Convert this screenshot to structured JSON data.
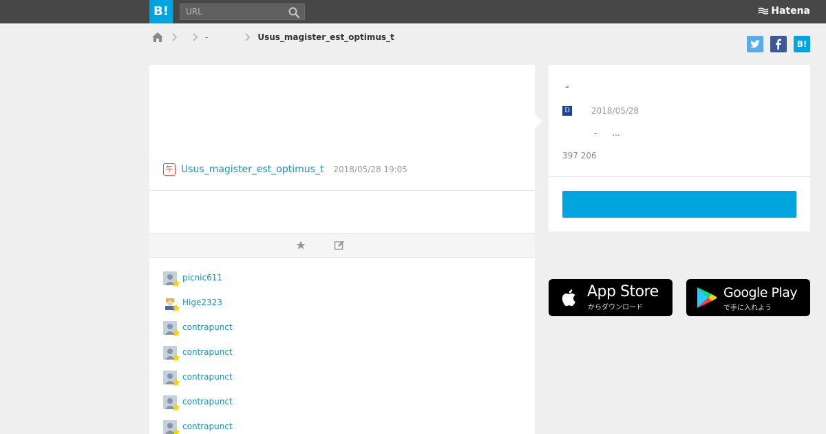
{
  "header": {
    "logo": "B!",
    "search_placeholder": "URL",
    "brand": "Hatena"
  },
  "breadcrumb": {
    "item_dash": "-",
    "current": "Usus_magister_est_optimus_t"
  },
  "share": {
    "twitter": "t",
    "facebook": "f",
    "hatena": "B!"
  },
  "entry": {
    "user_icon_char": "午",
    "user": "Usus_magister_est_optimus_t",
    "date": "2018/05/28 19:05"
  },
  "stars": [
    {
      "name": "picnic611"
    },
    {
      "name": "Hige2323"
    },
    {
      "name": "contrapunct"
    },
    {
      "name": "contrapunct"
    },
    {
      "name": "contrapunct"
    },
    {
      "name": "contrapunct"
    },
    {
      "name": "contrapunct"
    }
  ],
  "side": {
    "title": "-",
    "diary_icon": "D",
    "date": "2018/05/28",
    "desc_dash": "-",
    "desc_ellipsis": "...",
    "counts": "397 206"
  },
  "stores": {
    "apple_main": "App Store",
    "apple_sub": "からダウンロード",
    "google_main": "Google Play",
    "google_sub": "で手に入れよう"
  },
  "colors": {
    "topbar": "#474747",
    "accent": "#00a4de",
    "link": "#1a8fb4",
    "star": "#f5d300"
  }
}
